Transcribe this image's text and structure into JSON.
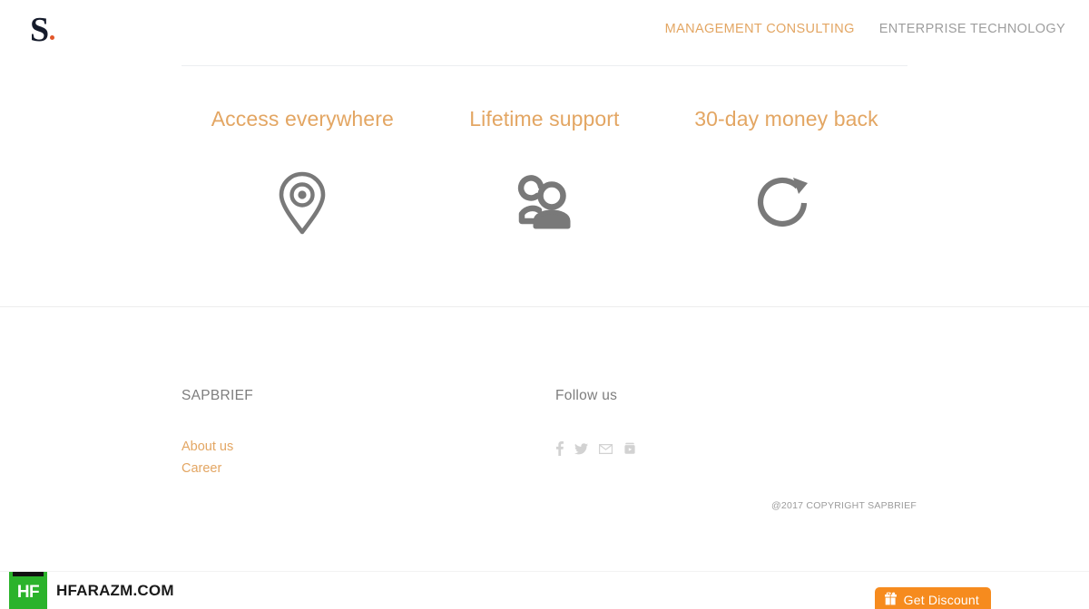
{
  "header": {
    "logo": {
      "letter": "S",
      "dot_color": "#e2562a",
      "letter_color": "#151b2b"
    },
    "nav": [
      {
        "label": "MANAGEMENT CONSULTING",
        "active": true
      },
      {
        "label": "ENTERPRISE TECHNOLOGY",
        "active": false
      }
    ]
  },
  "features": [
    {
      "title": "Access everywhere",
      "icon": "location-pin-icon"
    },
    {
      "title": "Lifetime support",
      "icon": "people-icon"
    },
    {
      "title": "30-day money back",
      "icon": "refresh-icon"
    }
  ],
  "footer": {
    "brand_column": {
      "heading": "SAPBRIEF",
      "links": [
        {
          "label": "About us"
        },
        {
          "label": "Career"
        }
      ]
    },
    "social_column": {
      "heading": "Follow us",
      "icons": [
        {
          "name": "facebook-icon"
        },
        {
          "name": "twitter-icon"
        },
        {
          "name": "email-icon"
        },
        {
          "name": "youtube-icon"
        }
      ]
    },
    "copyright": "@2017 COPYRIGHT SAPBRIEF"
  },
  "watermark": {
    "logo_text": "HF",
    "site_text": "HFARAZM.COM"
  },
  "discount": {
    "label": "Get Discount",
    "icon": "gift-icon",
    "color": "#f68b1e"
  },
  "colors": {
    "accent_orange": "#e3a663",
    "nav_gray": "#9e9e9e",
    "icon_gray": "#777777",
    "divider": "#ededed"
  }
}
